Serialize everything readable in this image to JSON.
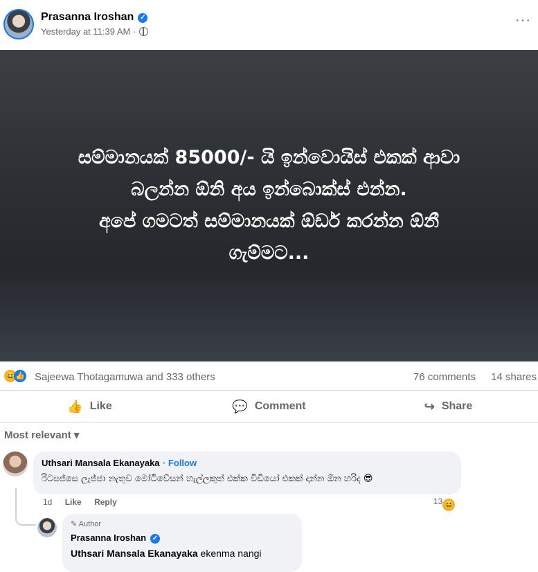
{
  "post": {
    "author": "Prasanna Iroshan",
    "timestamp": "Yesterday at 11:39 AM ·",
    "more": "···",
    "image_text": [
      "සම්මානයක් 85000/- යි ඉන්වොයිස් එකක් ආවා",
      "බලන්න ඕනි අය ඉන්බොක්ස් එන්න.",
      "අපේ ගමටත් සම්මානයක් ඕඩර් කරන්න ඕනී",
      "ගැම්මට..."
    ]
  },
  "stats": {
    "reactors": "Sajeewa Thotagamuwa and 333 others",
    "comments": "76 comments",
    "shares": "14 shares"
  },
  "actions": {
    "like": "Like",
    "comment": "Comment",
    "share": "Share"
  },
  "sort": "Most relevant",
  "comments": [
    {
      "name": "Uthsari Mansala Ekanayaka",
      "follow": "· Follow",
      "text": "රිටපජ්සෙ ලැජ්ජා නැතුව මෝටිවේසන් හැල්ලකුත් එක්ක විඩියෝ එකක් දාන්න ඕන හරිද 😎",
      "age": "1d",
      "like": "Like",
      "reply": "Reply",
      "reaction_count": "13"
    }
  ],
  "reply": {
    "badge": "Author",
    "name": "Prasanna Iroshan",
    "mention": "Uthsari Mansala Ekanayaka",
    "text": " ekenma nangi"
  }
}
